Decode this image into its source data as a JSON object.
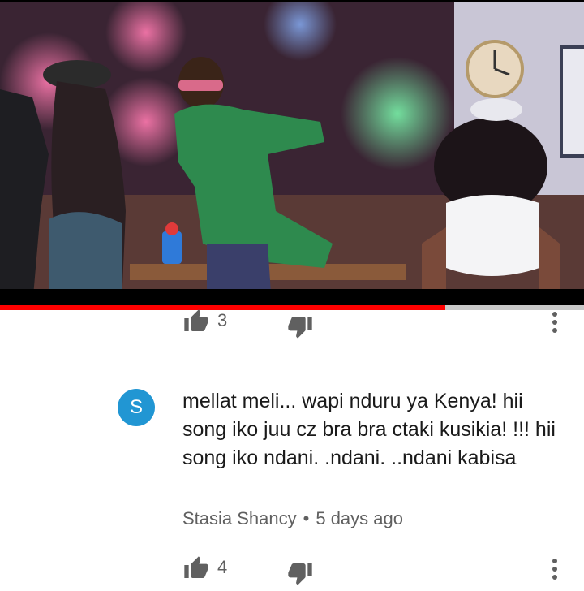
{
  "video": {
    "progress_fraction": 0.762,
    "accent_color": "#ff0000"
  },
  "prev_comment": {
    "like_count": "3",
    "like_icon": "thumbs-up-icon",
    "dislike_icon": "thumbs-down-icon",
    "more_icon": "more-vert-icon"
  },
  "comment": {
    "avatar_letter": "S",
    "avatar_color": "#2196d3",
    "text": "mellat meli... wapi nduru ya Kenya! hii song iko juu cz bra bra ctaki kusikia! !!! hii song iko ndani. .ndani. ..ndani kabisa",
    "author": "Stasia Shancy",
    "separator": "•",
    "time": "5 days ago",
    "like_count": "4"
  }
}
